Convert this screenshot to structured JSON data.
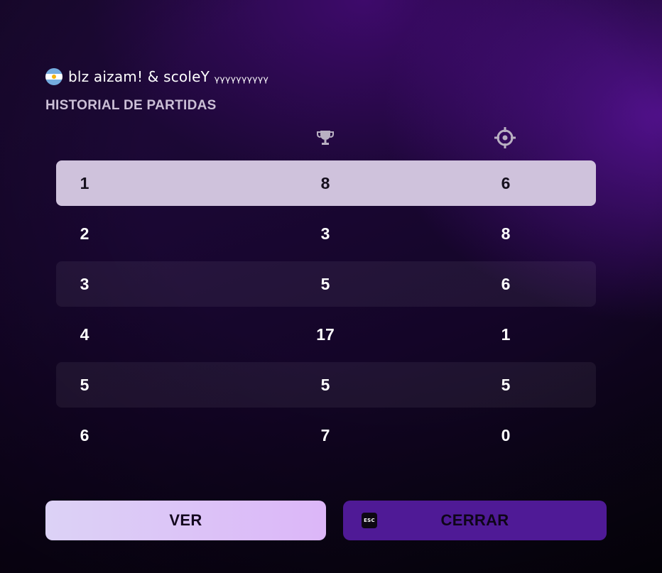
{
  "player": {
    "flag_icon": "argentina-flag-icon",
    "name": "blz aizam! & scoleY ᵧᵧᵧᵧᵧᵧᵧᵧᵧᵧ"
  },
  "section_title": "HISTORIAL DE PARTIDAS",
  "columns": [
    {
      "icon": "trophy-icon"
    },
    {
      "icon": "crosshair-icon"
    }
  ],
  "rows": [
    {
      "index": "1",
      "trophy": "8",
      "kills": "6",
      "state": "selected"
    },
    {
      "index": "2",
      "trophy": "3",
      "kills": "8",
      "state": "plain"
    },
    {
      "index": "3",
      "trophy": "5",
      "kills": "6",
      "state": "shaded"
    },
    {
      "index": "4",
      "trophy": "17",
      "kills": "1",
      "state": "plain"
    },
    {
      "index": "5",
      "trophy": "5",
      "kills": "5",
      "state": "shaded"
    },
    {
      "index": "6",
      "trophy": "7",
      "kills": "0",
      "state": "plain"
    }
  ],
  "buttons": {
    "view_label": "VER",
    "close_label": "CERRAR",
    "esc_key": "ESC"
  },
  "colors": {
    "selected_row": "#cfc2dc",
    "view_button": "#dcc4f7",
    "close_button": "#4f1a96",
    "background": "#1a0733"
  }
}
